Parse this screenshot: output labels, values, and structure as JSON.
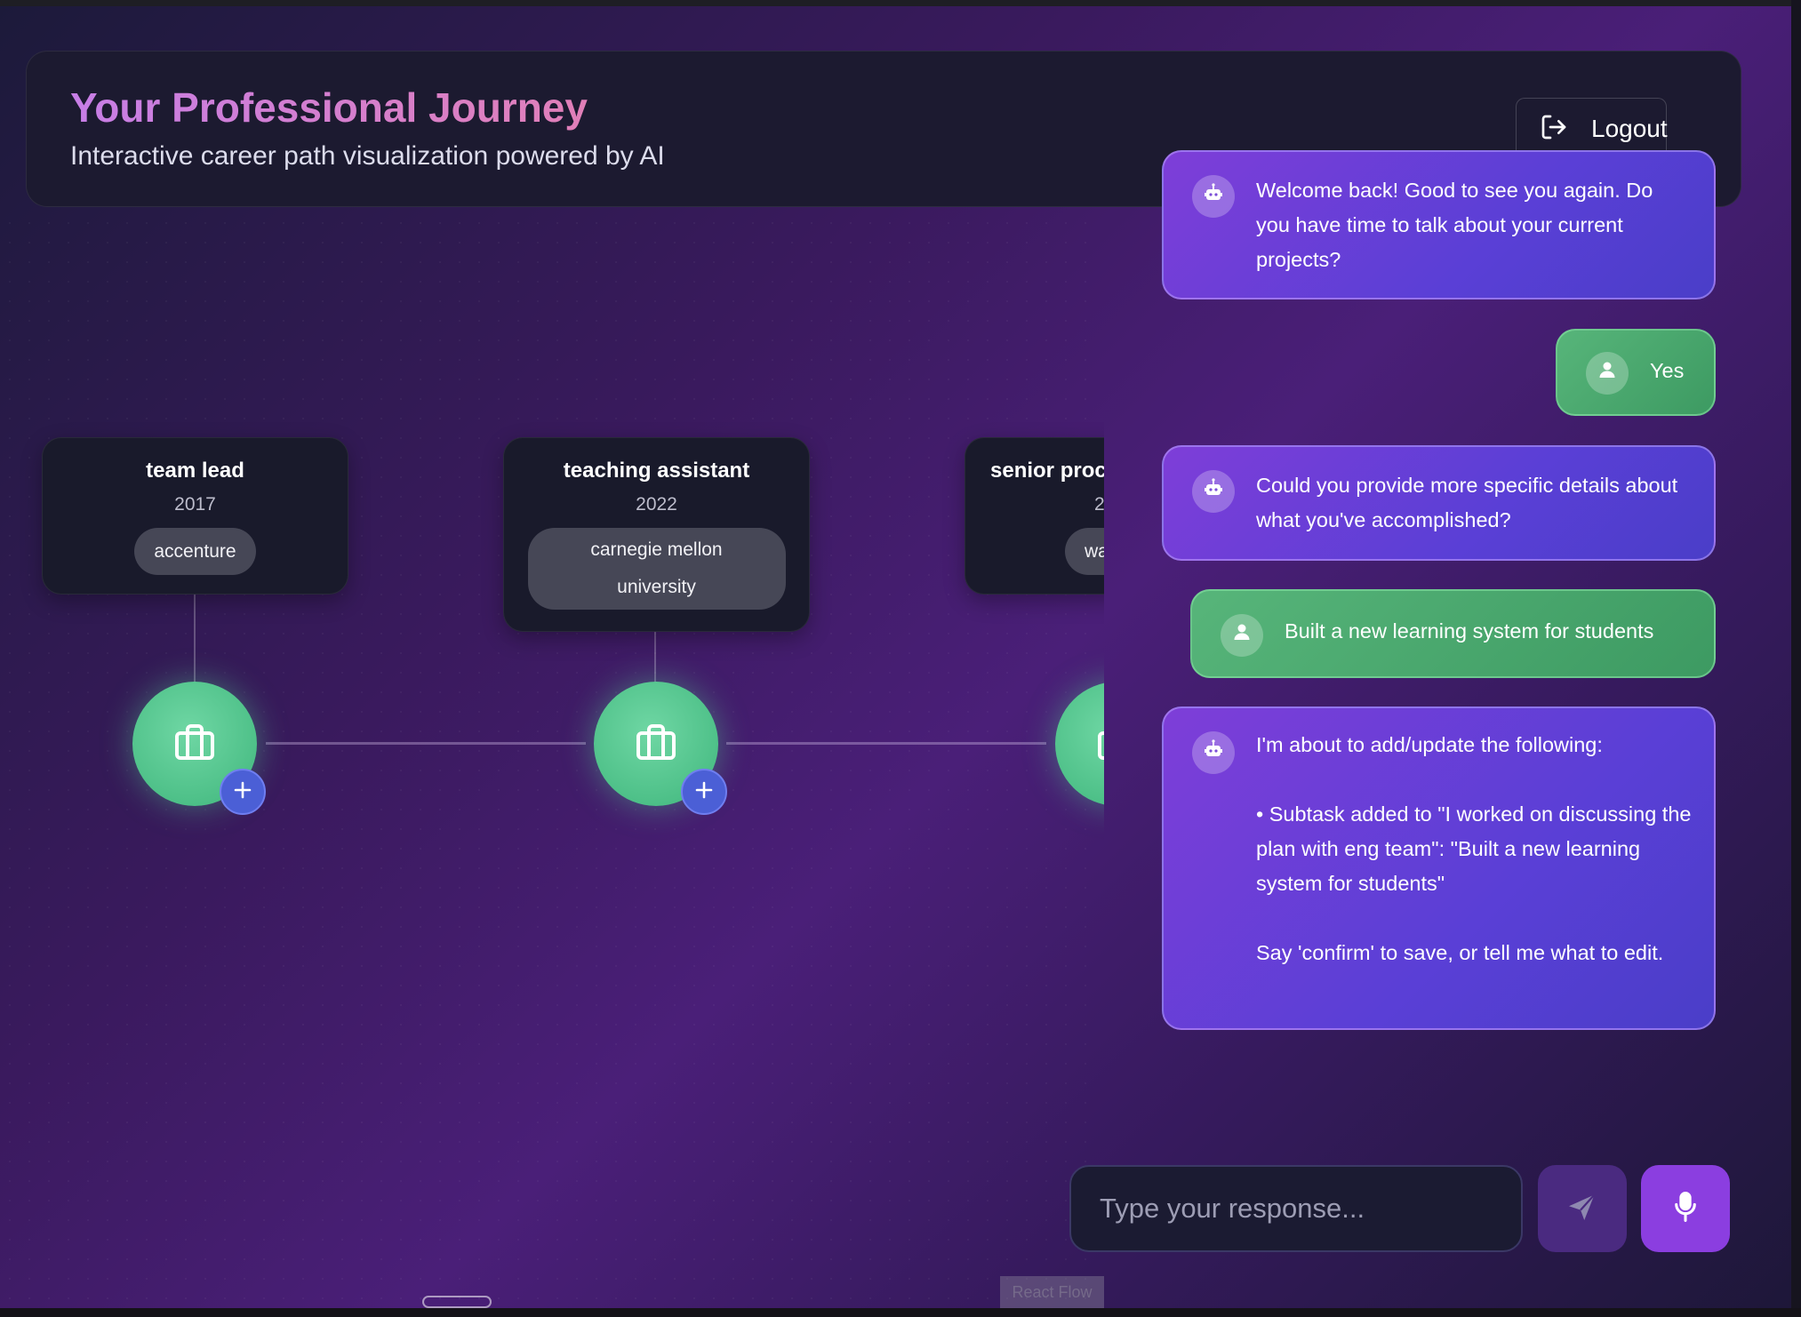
{
  "header": {
    "title": "Your Professional Journey",
    "subtitle": "Interactive career path visualization powered by AI",
    "logout_label": "Logout",
    "logout_icon": "logout-icon"
  },
  "timeline": [
    {
      "title": "team lead",
      "year": "2017",
      "org": "accenture"
    },
    {
      "title": "teaching assistant",
      "year": "2022",
      "org": "carnegie mellon university"
    },
    {
      "title": "senior proc",
      "year": "2",
      "org": "wa"
    }
  ],
  "node_icon": "briefcase-icon",
  "add_icon": "plus-icon",
  "chat": {
    "messages": [
      {
        "role": "bot",
        "text": "Welcome back! Good to see you again. Do you have time to talk about your current projects?"
      },
      {
        "role": "user",
        "text": "Yes"
      },
      {
        "role": "bot",
        "text": "Could you provide more specific details about what you've accomplished?"
      },
      {
        "role": "user",
        "text": "Built a new learning system for students"
      },
      {
        "role": "bot",
        "text": "I'm about to add/update the following:\n\n• Subtask added to \"I worked on discussing the plan with eng team\": \"Built a new learning system for students\"\n\nSay 'confirm' to save, or tell me what to edit."
      }
    ],
    "input_placeholder": "Type your response...",
    "input_value": "",
    "send_icon": "send-icon",
    "mic_icon": "microphone-icon"
  },
  "attribution": "React Flow",
  "colors": {
    "accent_purple": "#8b3ee0",
    "bot_bubble": "#6a3fd8",
    "user_bubble": "#4caa6e",
    "node_green": "#56c88f",
    "plus_blue": "#4b5fd6"
  }
}
